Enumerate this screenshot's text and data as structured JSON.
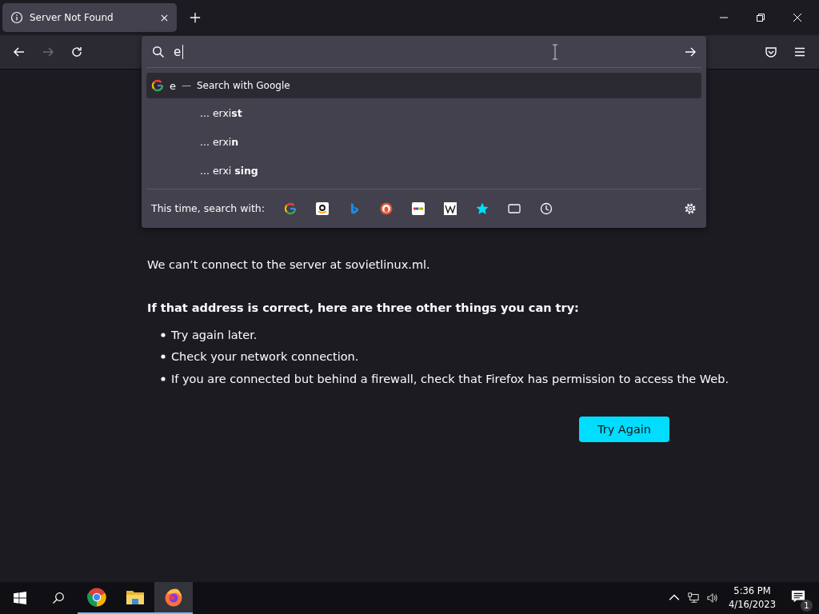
{
  "tabs": [
    {
      "title": "Server Not Found",
      "selected": true
    }
  ],
  "urlbar": {
    "value": "e"
  },
  "dropdown": {
    "heuristic": {
      "query": "e",
      "separator": "—",
      "action": "Search with Google",
      "selected": true
    },
    "suggestions": [
      {
        "text": "... erxi**st**"
      },
      {
        "text": "... erxi**n**"
      },
      {
        "text": "... erxi **sing**"
      }
    ],
    "search_with_label": "This time, search with:",
    "engines": [
      {
        "kind": "google"
      },
      {
        "kind": "amazon"
      },
      {
        "kind": "bing"
      },
      {
        "kind": "duck"
      },
      {
        "kind": "ebay"
      },
      {
        "kind": "wiki"
      },
      {
        "kind": "bookmarks"
      },
      {
        "kind": "tabs"
      },
      {
        "kind": "history"
      }
    ]
  },
  "page": {
    "message": "We can’t connect to the server at sovietlinux.ml.",
    "subheading": "If that address is correct, here are three other things you can try:",
    "tips": [
      "Try again later.",
      "Check your network connection.",
      "If you are connected but behind a firewall, check that Firefox has permission to access the Web."
    ],
    "button": "Try Again"
  },
  "taskbar": {
    "apps": [
      {
        "kind": "chrome",
        "active": false
      },
      {
        "kind": "files",
        "active": false
      },
      {
        "kind": "firefox",
        "active": true
      }
    ],
    "time": "5:36 PM",
    "date": "4/16/2023",
    "notification_count": "1"
  }
}
